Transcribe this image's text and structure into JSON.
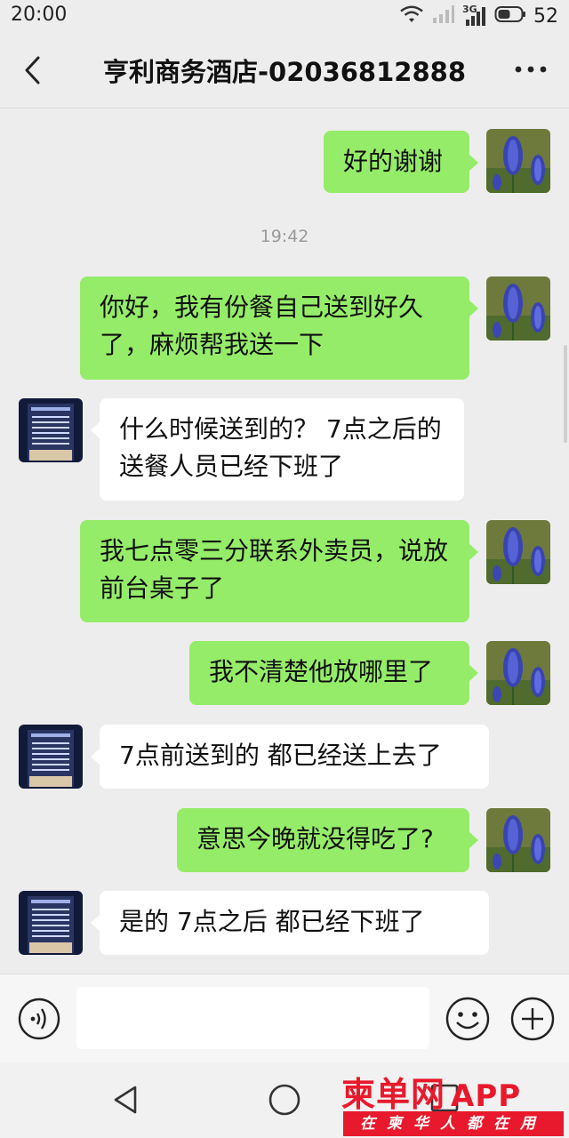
{
  "status_bar": {
    "time": "20:00",
    "network": "3G",
    "battery": "52",
    "icons": [
      "wifi-icon",
      "signal-icon",
      "signal-3g-icon",
      "battery-icon"
    ]
  },
  "header": {
    "title": "亨利商务酒店-02036812888",
    "back_icon": "chevron-left-icon",
    "more_icon": "more-dots-icon"
  },
  "messages": [
    {
      "from": "me",
      "text": "好的谢谢"
    },
    {
      "type": "time",
      "text": "19:42"
    },
    {
      "from": "me",
      "text": "你好，我有份餐自己送到好久了，麻烦帮我送一下"
    },
    {
      "from": "hotel",
      "text": "什么时候送到的？ 7点之后的 送餐人员已经下班了"
    },
    {
      "from": "me",
      "text": "我七点零三分联系外卖员，说放前台桌子了"
    },
    {
      "from": "me",
      "text": "我不清楚他放哪里了"
    },
    {
      "from": "hotel",
      "text": "7点前送到的 都已经送上去了"
    },
    {
      "from": "me",
      "text": "意思今晚就没得吃了?"
    },
    {
      "from": "hotel",
      "text": "是的 7点之后 都已经下班了"
    }
  ],
  "input_bar": {
    "value": "",
    "icons": [
      "voice-icon",
      "emoji-icon",
      "plus-icon"
    ]
  },
  "nav_bar": {
    "icons": [
      "nav-back-icon",
      "nav-home-icon",
      "nav-recent-icon"
    ]
  },
  "watermark": {
    "main": "柬单网",
    "app": "APP",
    "sub": "在柬华人都在用"
  },
  "colors": {
    "outgoing_bubble": "#95ec69",
    "incoming_bubble": "#ffffff",
    "background": "#ededed",
    "watermark_red": "#e8192c"
  }
}
